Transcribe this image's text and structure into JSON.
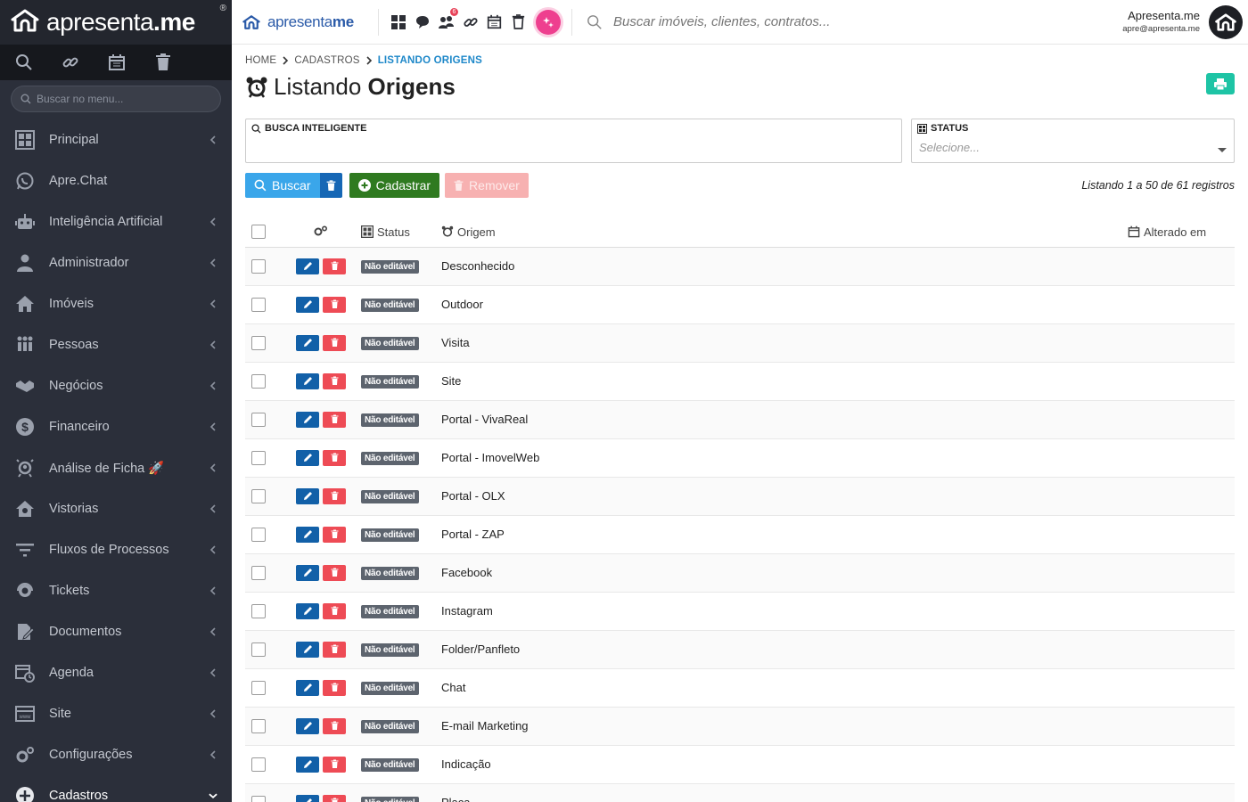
{
  "sidebar": {
    "brand_regular": "apresenta",
    "brand_bold": ".me",
    "brand_reg": "®",
    "quick_icons": [
      "search-icon",
      "link-icon",
      "calendar-icon",
      "trash-icon"
    ],
    "search_placeholder": "Buscar no menu...",
    "items": [
      {
        "label": "Principal",
        "icon": "dashboard-icon",
        "chevron": "left"
      },
      {
        "label": "Apre.Chat",
        "icon": "whatsapp-icon",
        "chevron": ""
      },
      {
        "label": "Inteligência Artificial",
        "icon": "robot-icon",
        "chevron": "left"
      },
      {
        "label": "Administrador",
        "icon": "user-tie-icon",
        "chevron": "left"
      },
      {
        "label": "Imóveis",
        "icon": "home-icon",
        "chevron": "left"
      },
      {
        "label": "Pessoas",
        "icon": "people-icon",
        "chevron": "left"
      },
      {
        "label": "Negócios",
        "icon": "handshake-icon",
        "chevron": "left"
      },
      {
        "label": "Financeiro",
        "icon": "dollar-icon",
        "chevron": "left"
      },
      {
        "label": "Análise de Ficha 🚀",
        "icon": "user-search-icon",
        "chevron": "left"
      },
      {
        "label": "Vistorias",
        "icon": "house-search-icon",
        "chevron": "left"
      },
      {
        "label": "Fluxos de Processos",
        "icon": "filter-icon",
        "chevron": "left"
      },
      {
        "label": "Tickets",
        "icon": "headset-icon",
        "chevron": "left"
      },
      {
        "label": "Documentos",
        "icon": "document-edit-icon",
        "chevron": "left"
      },
      {
        "label": "Agenda",
        "icon": "calendar-clock-icon",
        "chevron": "left"
      },
      {
        "label": "Site",
        "icon": "browser-icon",
        "chevron": "left"
      },
      {
        "label": "Configurações",
        "icon": "gears-icon",
        "chevron": "left"
      },
      {
        "label": "Cadastros",
        "icon": "plus-circle-icon",
        "chevron": "down"
      }
    ]
  },
  "topbar": {
    "logo_regular": "apresenta",
    "logo_bold": "me",
    "notification_count": "6",
    "search_placeholder": "Buscar imóveis, clientes, contratos...",
    "user_name": "Apresenta.me",
    "user_email": "apre@apresenta.me"
  },
  "breadcrumb": [
    "HOME",
    "CADASTROS",
    "LISTANDO ORIGENS"
  ],
  "page": {
    "title_regular": "Listando",
    "title_bold": "Origens"
  },
  "filters": {
    "smart_search_label": "BUSCA INTELIGENTE",
    "smart_search_value": "",
    "status_label": "STATUS",
    "status_placeholder": "Selecione..."
  },
  "actions": {
    "search_label": "Buscar",
    "register_label": "Cadastrar",
    "remove_label": "Remover",
    "count_text": "Listando 1 a 50 de 61 registros"
  },
  "table": {
    "headers": {
      "status": "Status",
      "origin": "Origem",
      "updated": "Alterado em"
    },
    "rows": [
      {
        "status": "Não editável",
        "origin": "Desconhecido",
        "updated": ""
      },
      {
        "status": "Não editável",
        "origin": "Outdoor",
        "updated": ""
      },
      {
        "status": "Não editável",
        "origin": "Visita",
        "updated": ""
      },
      {
        "status": "Não editável",
        "origin": "Site",
        "updated": ""
      },
      {
        "status": "Não editável",
        "origin": "Portal - VivaReal",
        "updated": ""
      },
      {
        "status": "Não editável",
        "origin": "Portal - ImovelWeb",
        "updated": ""
      },
      {
        "status": "Não editável",
        "origin": "Portal - OLX",
        "updated": ""
      },
      {
        "status": "Não editável",
        "origin": "Portal - ZAP",
        "updated": ""
      },
      {
        "status": "Não editável",
        "origin": "Facebook",
        "updated": ""
      },
      {
        "status": "Não editável",
        "origin": "Instagram",
        "updated": ""
      },
      {
        "status": "Não editável",
        "origin": "Folder/Panfleto",
        "updated": ""
      },
      {
        "status": "Não editável",
        "origin": "Chat",
        "updated": ""
      },
      {
        "status": "Não editável",
        "origin": "E-mail Marketing",
        "updated": ""
      },
      {
        "status": "Não editável",
        "origin": "Indicação",
        "updated": ""
      },
      {
        "status": "Não editável",
        "origin": "Placa",
        "updated": ""
      }
    ]
  },
  "colors": {
    "sidebar_bg": "#2b2f3a",
    "accent_blue": "#1e88c9",
    "print_button": "#1ec4a5",
    "register_green": "#2f7a20",
    "remove_red": "#ee4b55"
  }
}
